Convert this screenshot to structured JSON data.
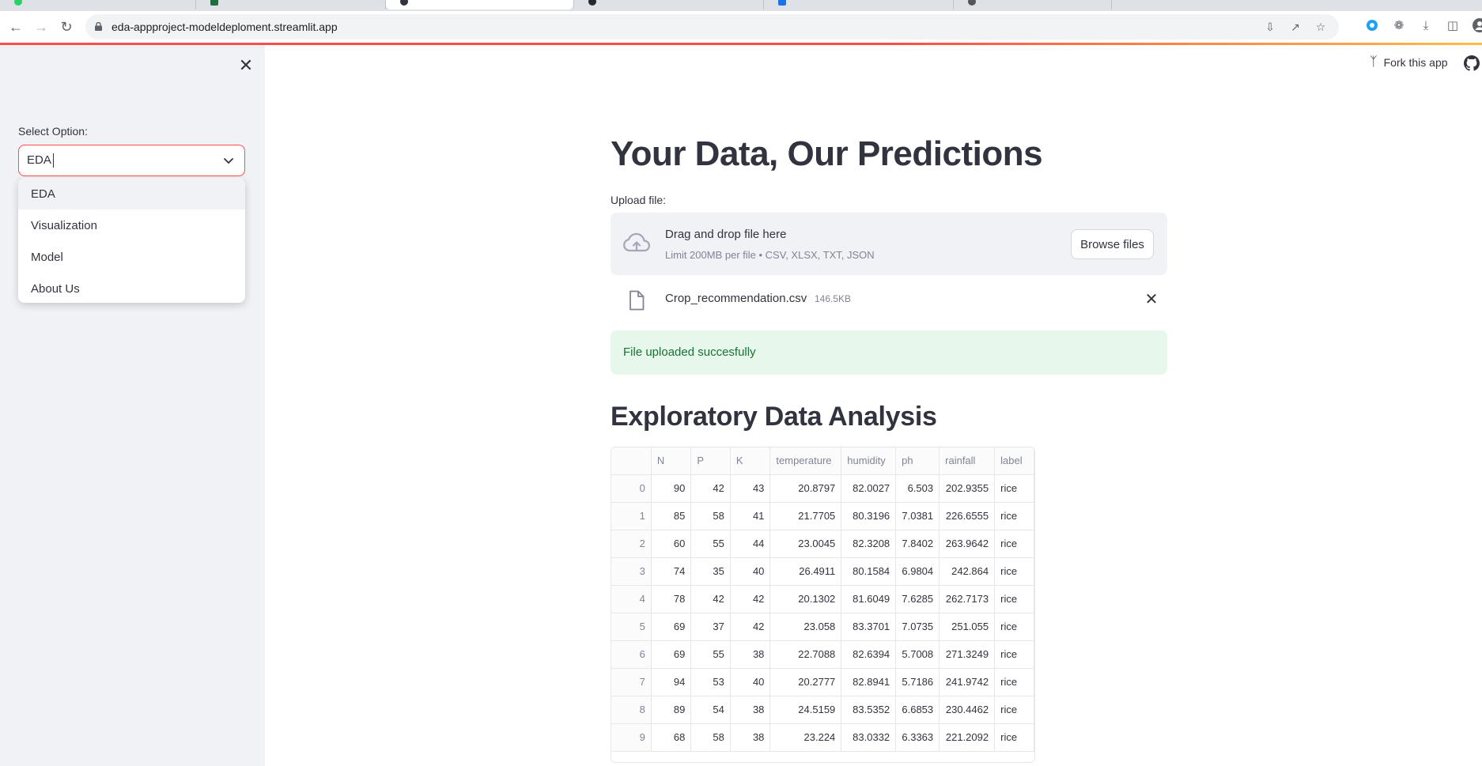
{
  "browser": {
    "url": "eda-appproject-modeldeploment.streamlit.app"
  },
  "app": {
    "fork_label": "Fork this app"
  },
  "sidebar": {
    "select_label": "Select Option:",
    "select_value": "EDA",
    "options": [
      "EDA",
      "Visualization",
      "Model",
      "About Us"
    ]
  },
  "main": {
    "title": "Your Data, Our Predictions",
    "upload": {
      "label": "Upload file:",
      "dropzone_title": "Drag and drop file here",
      "dropzone_subtitle": "Limit 200MB per file • CSV, XLSX, TXT, JSON",
      "browse_label": "Browse files",
      "file_name": "Crop_recommendation.csv",
      "file_size": "146.5KB"
    },
    "success_message": "File uploaded succesfully",
    "eda_heading": "Exploratory Data Analysis",
    "table": {
      "columns": [
        "",
        "N",
        "P",
        "K",
        "temperature",
        "humidity",
        "ph",
        "rainfall",
        "label"
      ],
      "rows": [
        [
          "0",
          "90",
          "42",
          "43",
          "20.8797",
          "82.0027",
          "6.503",
          "202.9355",
          "rice"
        ],
        [
          "1",
          "85",
          "58",
          "41",
          "21.7705",
          "80.3196",
          "7.0381",
          "226.6555",
          "rice"
        ],
        [
          "2",
          "60",
          "55",
          "44",
          "23.0045",
          "82.3208",
          "7.8402",
          "263.9642",
          "rice"
        ],
        [
          "3",
          "74",
          "35",
          "40",
          "26.4911",
          "80.1584",
          "6.9804",
          "242.864",
          "rice"
        ],
        [
          "4",
          "78",
          "42",
          "42",
          "20.1302",
          "81.6049",
          "7.6285",
          "262.7173",
          "rice"
        ],
        [
          "5",
          "69",
          "37",
          "42",
          "23.058",
          "83.3701",
          "7.0735",
          "251.055",
          "rice"
        ],
        [
          "6",
          "69",
          "55",
          "38",
          "22.7088",
          "82.6394",
          "5.7008",
          "271.3249",
          "rice"
        ],
        [
          "7",
          "94",
          "53",
          "40",
          "20.2777",
          "82.8941",
          "5.7186",
          "241.9742",
          "rice"
        ],
        [
          "8",
          "89",
          "54",
          "38",
          "24.5159",
          "83.5352",
          "6.6853",
          "230.4462",
          "rice"
        ],
        [
          "9",
          "68",
          "58",
          "38",
          "23.224",
          "83.0332",
          "6.3363",
          "221.2092",
          "rice"
        ]
      ]
    }
  },
  "colors": {
    "accent": "#ff4b4b",
    "sidebar_bg": "#f0f2f6",
    "success_bg": "#e8f7ec",
    "success_text": "#177233",
    "text": "#31333f",
    "muted": "#808495"
  }
}
